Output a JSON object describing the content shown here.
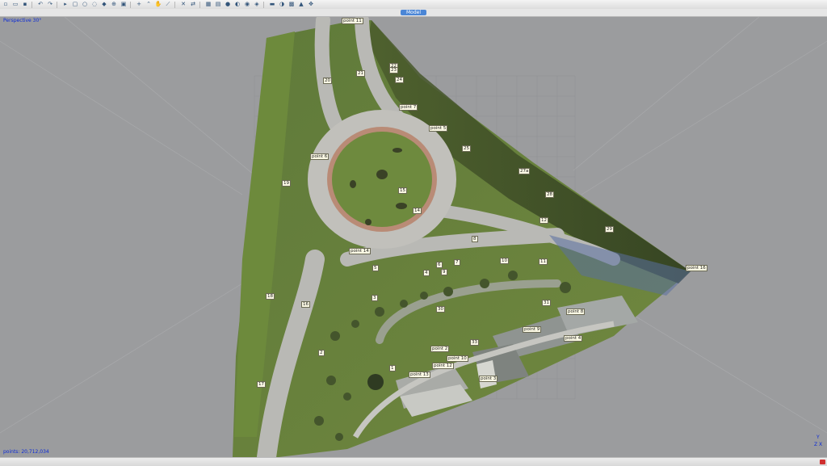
{
  "window": {
    "tab_label": "Model",
    "view_mode": "Perspective 30°",
    "points_count": "points: 20,712,034"
  },
  "toolbar": {
    "icons": [
      "new-icon",
      "open-icon",
      "save-icon",
      "sep",
      "undo-icon",
      "redo-icon",
      "sep",
      "select-icon",
      "rect-select-icon",
      "circle-select-icon",
      "lasso-icon",
      "paint-icon",
      "zoom-icon",
      "fit-icon",
      "sep",
      "add-point-icon",
      "polyline-icon",
      "hand-icon",
      "measure-icon",
      "sep",
      "delete-icon",
      "transform-icon",
      "sep",
      "grid-icon",
      "layer-icon",
      "color-icon",
      "light-icon",
      "nav-icon",
      "filter-icon",
      "sep",
      "camera-icon",
      "view-icon",
      "frame-icon",
      "top-view-icon",
      "move-icon"
    ]
  },
  "axes": {
    "y": "Y",
    "zx": "Z X"
  },
  "colors": {
    "viewport_bg": "#9b9c9e",
    "label_bg": "#fbf9e4",
    "overlay_text": "#0b2ad8",
    "tab_active": "#4b86d6"
  },
  "markers": [
    {
      "id": "m-point-11",
      "text": "point 11"
    },
    {
      "id": "m-20",
      "text": "20"
    },
    {
      "id": "m-21",
      "text": "21"
    },
    {
      "id": "m-22",
      "text": "22"
    },
    {
      "id": "m-23",
      "text": "23"
    },
    {
      "id": "m-24",
      "text": "24"
    },
    {
      "id": "m-point-7",
      "text": "point 7"
    },
    {
      "id": "m-point-6",
      "text": "point 6"
    },
    {
      "id": "m-25",
      "text": "25"
    },
    {
      "id": "m-point-5",
      "text": "point 5"
    },
    {
      "id": "m-27",
      "text": "27a"
    },
    {
      "id": "m-19",
      "text": "19"
    },
    {
      "id": "m-15",
      "text": "15"
    },
    {
      "id": "m-28",
      "text": "28"
    },
    {
      "id": "m-14",
      "text": "14"
    },
    {
      "id": "m-12",
      "text": "12"
    },
    {
      "id": "m-29",
      "text": "29"
    },
    {
      "id": "m-8",
      "text": "8"
    },
    {
      "id": "m-point-14",
      "text": "point 14"
    },
    {
      "id": "m-5",
      "text": "5"
    },
    {
      "id": "m-7",
      "text": "7"
    },
    {
      "id": "m-6",
      "text": "6"
    },
    {
      "id": "m-10",
      "text": "10"
    },
    {
      "id": "m-11",
      "text": "11"
    },
    {
      "id": "m-4",
      "text": "4"
    },
    {
      "id": "m-9",
      "text": "9"
    },
    {
      "id": "m-point-16",
      "text": "point 16"
    },
    {
      "id": "m-18",
      "text": "18"
    },
    {
      "id": "m-16",
      "text": "16"
    },
    {
      "id": "m-3",
      "text": "3"
    },
    {
      "id": "m-31",
      "text": "31"
    },
    {
      "id": "m-30",
      "text": "30"
    },
    {
      "id": "m-point-8",
      "text": "point 8"
    },
    {
      "id": "m-point-9",
      "text": "point 9"
    },
    {
      "id": "m-point-4",
      "text": "point 4"
    },
    {
      "id": "m-33",
      "text": "33"
    },
    {
      "id": "m-point-2",
      "text": "point 2"
    },
    {
      "id": "m-point-10",
      "text": "point 10"
    },
    {
      "id": "m-2",
      "text": "2"
    },
    {
      "id": "m-point-12",
      "text": "point 12"
    },
    {
      "id": "m-1",
      "text": "1"
    },
    {
      "id": "m-point-13",
      "text": "point 13"
    },
    {
      "id": "m-point-3",
      "text": "point 3"
    },
    {
      "id": "m-17",
      "text": "17"
    }
  ]
}
